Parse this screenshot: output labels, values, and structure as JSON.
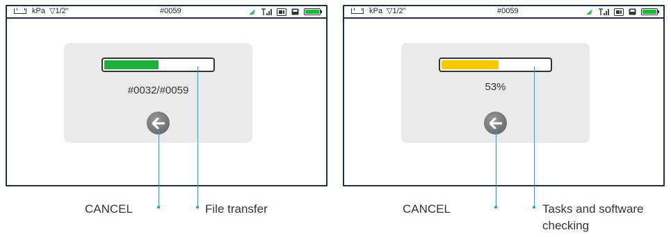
{
  "screens": [
    {
      "status": {
        "unit": "kPa",
        "gauge": "▽1/2\"",
        "file": "#0059"
      },
      "progress": {
        "fraction": 0.5,
        "color": "#1fae3b",
        "text": "#0032/#0059"
      }
    },
    {
      "status": {
        "unit": "kPa",
        "gauge": "▽1/2\"",
        "file": "#0059"
      },
      "progress": {
        "fraction": 0.53,
        "color": "#f5c800",
        "text": "53%"
      }
    }
  ],
  "labels": {
    "left_cancel": "CANCEL",
    "left_transfer": "File transfer",
    "right_cancel": "CANCEL",
    "right_tasks_1": "Tasks and software",
    "right_tasks_2": "checking"
  },
  "icons": {
    "status": [
      "ruler-icon",
      "gps-icon",
      "signal-icon",
      "sd-card-icon",
      "usb-icon",
      "battery-icon"
    ],
    "button": "back-arrow-icon"
  },
  "colors": {
    "callout": "#1e9fd6",
    "battery": "#19b93a"
  }
}
